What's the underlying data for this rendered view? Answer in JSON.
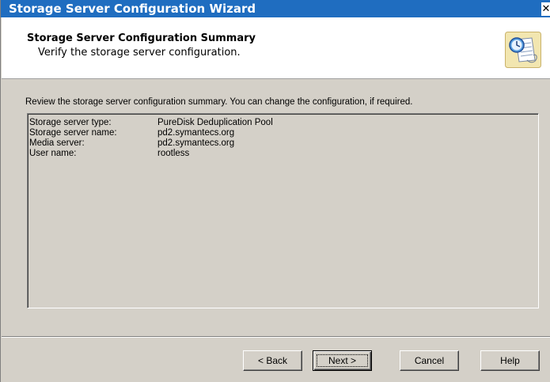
{
  "window": {
    "title": "Storage Server Configuration Wizard",
    "close_glyph": "✕"
  },
  "header": {
    "title": "Storage Server Configuration Summary",
    "subtitle": "Verify the storage server configuration.",
    "icon": "wizard-document-clock-icon"
  },
  "instructions": "Review the storage server configuration summary. You can change the configuration, if required.",
  "summary": {
    "rows": [
      {
        "label": "Storage server type:",
        "value": "PureDisk Deduplication Pool"
      },
      {
        "label": "Storage server name:",
        "value": "pd2.symantecs.org"
      },
      {
        "label": "Media server:",
        "value": "pd2.symantecs.org"
      },
      {
        "label": "User name:",
        "value": "rootless"
      }
    ]
  },
  "buttons": {
    "back": "< Back",
    "next": "Next >",
    "cancel": "Cancel",
    "help": "Help"
  },
  "colors": {
    "titlebar": "#1f6dc0",
    "dialog_bg": "#d4d0c8",
    "header_bg": "#ffffff"
  }
}
